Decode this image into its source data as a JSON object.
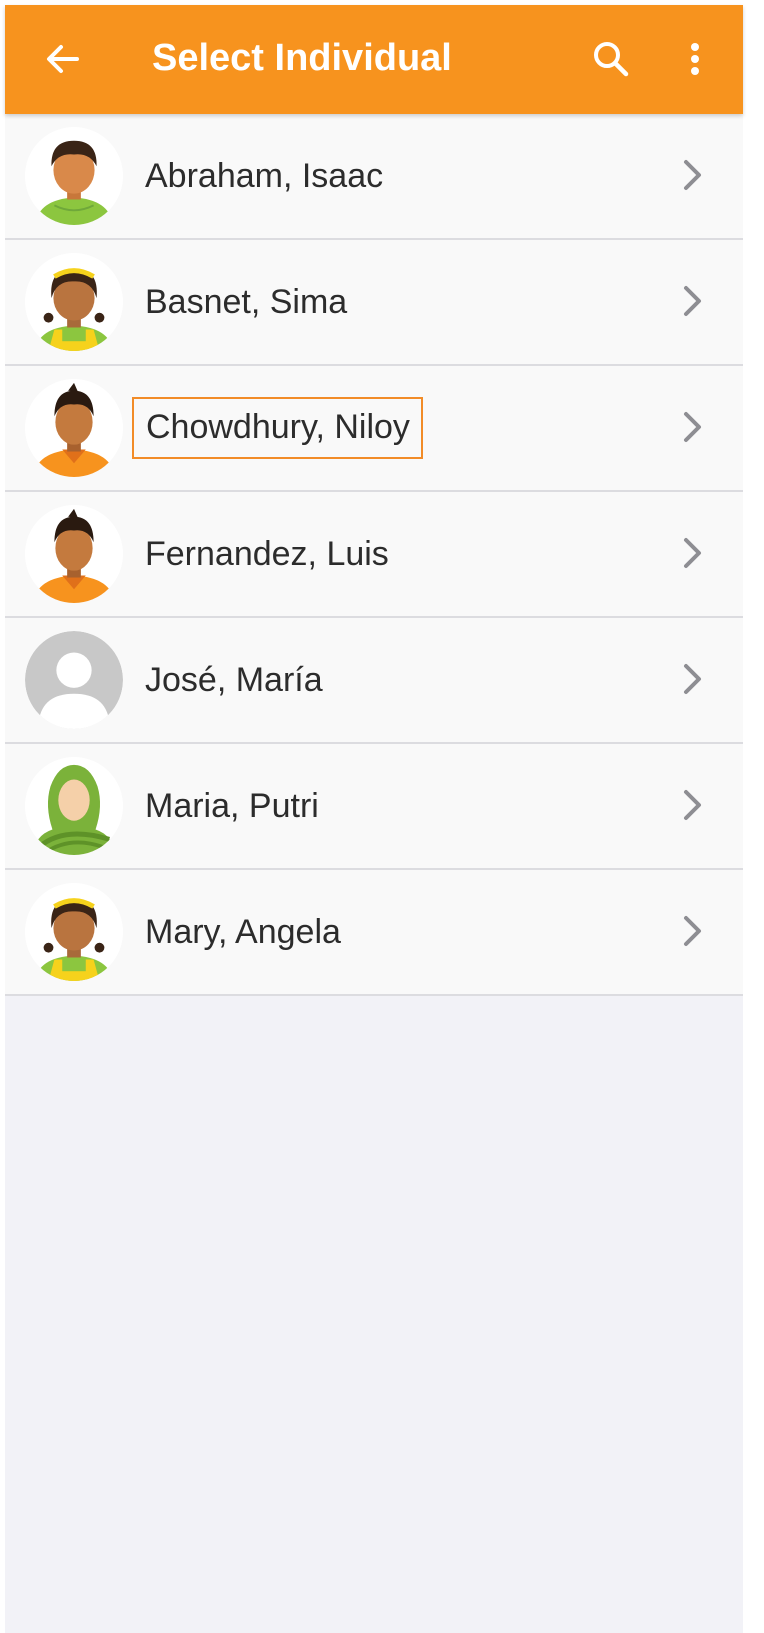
{
  "app_bar": {
    "title": "Select Individual",
    "back_icon": "arrow-left-icon",
    "search_icon": "search-icon",
    "more_icon": "more-vertical-icon",
    "color": "#f7931e"
  },
  "individuals": [
    {
      "name": "Abraham, Isaac",
      "avatar": "boy-avatar-green"
    },
    {
      "name": "Basnet, Sima",
      "avatar": "girl-avatar-yellow"
    },
    {
      "name": "Chowdhury, Niloy",
      "avatar": "boy-avatar-orange",
      "highlighted": true
    },
    {
      "name": "Fernandez, Luis",
      "avatar": "boy-avatar-orange"
    },
    {
      "name": "José, María",
      "avatar": "placeholder-avatar"
    },
    {
      "name": "Maria, Putri",
      "avatar": "hijab-avatar-green"
    },
    {
      "name": "Mary, Angela",
      "avatar": "girl-avatar-yellow"
    }
  ],
  "row_icon": "chevron-right-icon",
  "highlight_color": "#f28c28"
}
